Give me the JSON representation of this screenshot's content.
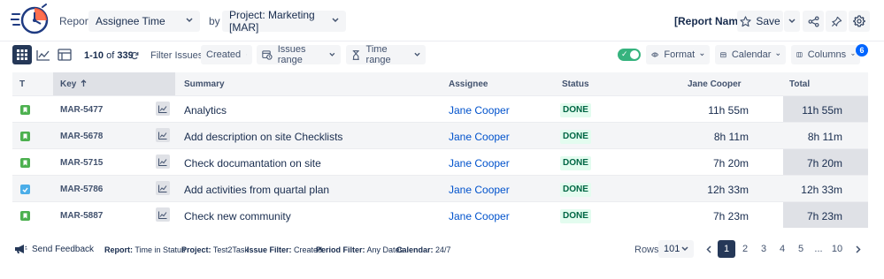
{
  "header": {
    "report_label": "Report:",
    "report_value": "Assignee Time",
    "by_label": "by",
    "project_value": "Project: Marketing [MAR]",
    "report_name": "[Report Name]",
    "report_name_suffix": " -",
    "save_label": "Save"
  },
  "toolbar": {
    "count_range": "1-10",
    "count_of": " of ",
    "count_total": "339",
    "filter_label": "Filter Issues:",
    "filter_value": "Created",
    "issues_range_label": "Issues range",
    "time_range_label": "Time range",
    "format_label": "Format",
    "calendar_label": "Calendar",
    "columns_label": "Columns",
    "columns_badge": "6"
  },
  "table": {
    "headers": {
      "type": "T",
      "key": "Key",
      "summary": "Summary",
      "assignee": "Assignee",
      "status": "Status",
      "person": "Jane Cooper",
      "total": "Total"
    },
    "rows": [
      {
        "type": "story",
        "key": "MAR-5477",
        "summary": "Analytics",
        "assignee": "Jane Cooper",
        "status": "DONE",
        "person_time": "11h 55m",
        "total": "11h 55m"
      },
      {
        "type": "story",
        "key": "MAR-5678",
        "summary": "Add description on site Checklists",
        "assignee": "Jane Cooper",
        "status": "DONE",
        "person_time": "8h 11m",
        "total": "8h 11m"
      },
      {
        "type": "story",
        "key": "MAR-5715",
        "summary": "Check documantation on site",
        "assignee": "Jane Cooper",
        "status": "DONE",
        "person_time": "7h 20m",
        "total": "7h 20m"
      },
      {
        "type": "task",
        "key": "MAR-5786",
        "summary": "Add activities from quartal plan",
        "assignee": "Jane Cooper",
        "status": "DONE",
        "person_time": "12h 33m",
        "total": "12h 33m"
      },
      {
        "type": "story",
        "key": "MAR-5887",
        "summary": "Check new community",
        "assignee": "Jane Cooper",
        "status": "DONE",
        "person_time": "7h 23m",
        "total": "7h 23m"
      }
    ]
  },
  "footer": {
    "feedback_label": "Send Feedback",
    "report_k": "Report:",
    "report_v": "Time in Status",
    "project_k": "Project:",
    "project_v": "Test2Task",
    "issue_filter_k": "Issue Filter:",
    "issue_filter_v": "Created",
    "period_filter_k": "Period Filter:",
    "period_filter_v": "Any Dates",
    "calendar_k": "Calendar:",
    "calendar_v": "24/7",
    "rows_label": "Rows:",
    "rows_value": "101",
    "pages": [
      "1",
      "2",
      "3",
      "4",
      "5",
      "...",
      "10"
    ],
    "active_page": "1"
  },
  "colors": {
    "story": "#4cb04f",
    "task": "#4bade8",
    "accent": "#0052cc",
    "done_bg": "#e3fcef",
    "done_fg": "#006644",
    "toggle_on": "#36b37e"
  }
}
